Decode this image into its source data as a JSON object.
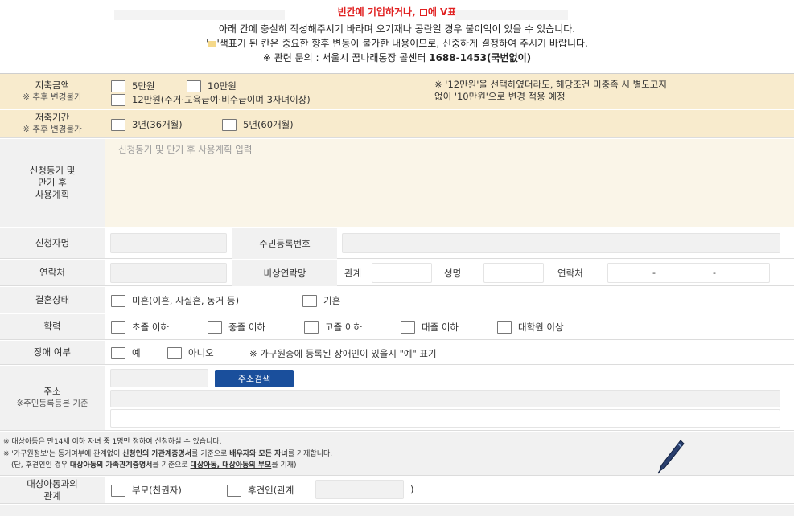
{
  "notice": {
    "line1": "빈칸에 기입하거나, ",
    "line1_box": "에 V표 ",
    "line2": "아래 칸에 충실히 작성해주시기 바라며 오기재나 공란일 경우 불이익이 있을 수 있습니다.",
    "line3_prefix": "'",
    "line3": "'색표기 된 칸은 중요한 향후 변동이 불가한 내용이므로, 신중하게 결정하여 주시기 바랍니다.",
    "line4_prefix": "※ 관련 문의 : 서울시 꿈나래통장 콜센터 ",
    "line4_bold": "1688-1453(국번없이)"
  },
  "savings_amount": {
    "label": "저축금액",
    "sub": "※ 추후 변경불가",
    "options": [
      "5만원",
      "10만원",
      "12만원(주거·교육급여·비수급이며 3자녀이상)"
    ],
    "note_line1": "※ '12만원'을 선택하였더라도, 해당조건 미충족 시 별도고지",
    "note_line2": "없이 '10만원'으로 변경 적용 예정"
  },
  "savings_period": {
    "label": "저축기간",
    "sub": "※ 추후 변경불가",
    "options": [
      "3년(36개월)",
      "5년(60개월)"
    ]
  },
  "motive": {
    "label_1": "신청동기 및",
    "label_2": "만기 후",
    "label_3": "사용계획",
    "placeholder": "신청동기 및 만기 후 사용계획 입력"
  },
  "applicant": {
    "name_label": "신청자명",
    "rrn_label": "주민등록번호"
  },
  "contact": {
    "label": "연락처",
    "emergency_label": "비상연락망",
    "relation_label": "관계",
    "name_label": "성명",
    "phone_label": "연락처",
    "dash1": "-",
    "dash2": "-"
  },
  "marital": {
    "label": "결혼상태",
    "options": [
      "미혼(이혼, 사실혼, 동거 등)",
      "기혼"
    ]
  },
  "education": {
    "label": "학력",
    "options": [
      "초졸 이하",
      "중졸 이하",
      "고졸 이하",
      "대졸 이하",
      "대학원 이상"
    ]
  },
  "disability": {
    "label": "장애 여부",
    "options": [
      "예",
      "아니오"
    ],
    "note": "※ 가구원중에 등록된 장애인이 있을시 \"예\" 표기"
  },
  "address": {
    "label": "주소",
    "sub": "※주민등록등본 기준",
    "search_button": "주소검색"
  },
  "notes": {
    "line1": "※ 대상아동은 만14세 이하 자녀 중 1명만 정하여 신청하실 수 있습니다.",
    "line2_a": "※ '가구원정보'는 동거여부에 관계없이 ",
    "line2_b": "신청인의 가관계증명서",
    "line2_c": "를 기준으로 ",
    "line2_d": "배우자와 모든 자녀",
    "line2_e": "를 기재합니다.",
    "line3_a": "(단, 후견인인 경우 ",
    "line3_b": "대상아동의 가족관계증명서",
    "line3_c": "를 기준으로 ",
    "line3_d": "대상아동, 대상아동의 부모",
    "line3_e": "를 기재)"
  },
  "relation": {
    "label_1": "대상아동과의",
    "label_2": "관계",
    "options": [
      "부모(친권자)",
      "후견인(관계"
    ],
    "close_paren": ")"
  }
}
